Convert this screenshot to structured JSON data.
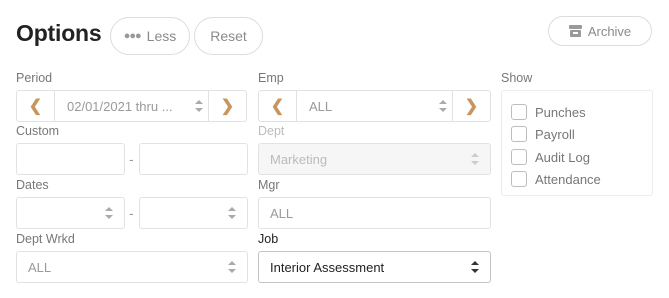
{
  "header": {
    "title": "Options",
    "less_label": "Less",
    "reset_label": "Reset",
    "archive_label": "Archive"
  },
  "fields": {
    "period": {
      "label": "Period",
      "value": "02/01/2021 thru ..."
    },
    "emp": {
      "label": "Emp",
      "value": "ALL"
    },
    "custom": {
      "label": "Custom",
      "start": "",
      "end": "",
      "separator": "-"
    },
    "dept": {
      "label": "Dept",
      "value": "Marketing"
    },
    "dates": {
      "label": "Dates",
      "start": "",
      "end": "",
      "separator": "-"
    },
    "mgr": {
      "label": "Mgr",
      "value": "ALL"
    },
    "dept_wrkd": {
      "label": "Dept Wrkd",
      "value": "ALL"
    },
    "job": {
      "label": "Job",
      "value": "Interior Assessment"
    }
  },
  "show": {
    "label": "Show",
    "options": [
      {
        "label": "Punches",
        "checked": false
      },
      {
        "label": "Payroll",
        "checked": false
      },
      {
        "label": "Audit Log",
        "checked": false
      },
      {
        "label": "Attendance",
        "checked": false
      }
    ]
  },
  "colors": {
    "nav_arrow": "#c8955e",
    "border": "#e2e2e2"
  }
}
